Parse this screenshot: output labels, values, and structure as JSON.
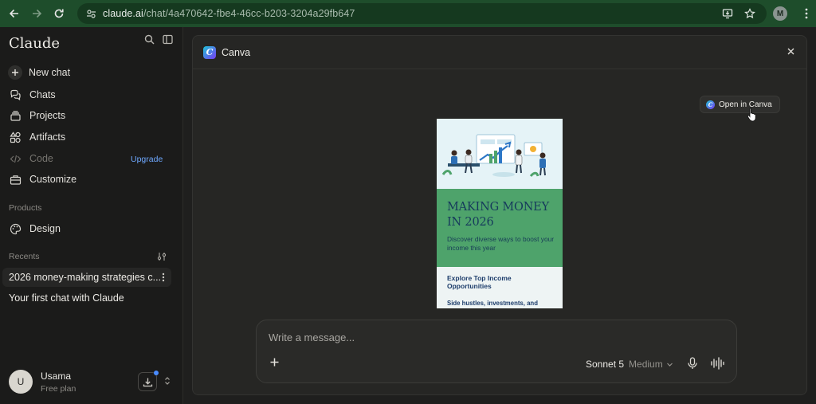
{
  "browser": {
    "url_host": "claude.ai",
    "url_path": "/chat/4a470642-fbe4-46cc-b203-3204a29fb647",
    "profile_initial": "M"
  },
  "sidebar": {
    "brand": "Claude",
    "items": [
      {
        "label": "New chat",
        "icon": "plus-icon"
      },
      {
        "label": "Chats",
        "icon": "chat-bubbles-icon"
      },
      {
        "label": "Projects",
        "icon": "folder-stack-icon"
      },
      {
        "label": "Artifacts",
        "icon": "shapes-icon"
      },
      {
        "label": "Code",
        "icon": "code-icon",
        "badge": "Upgrade"
      },
      {
        "label": "Customize",
        "icon": "briefcase-icon"
      }
    ],
    "products_label": "Products",
    "products": [
      {
        "label": "Design",
        "icon": "palette-icon"
      }
    ],
    "recents_label": "Recents",
    "recents": [
      {
        "label": "2026 money-making strategies c..."
      },
      {
        "label": "Your first chat with Claude"
      }
    ],
    "user": {
      "initial": "U",
      "name": "Usama",
      "plan": "Free plan"
    }
  },
  "panel": {
    "title": "Canva",
    "open_button": "Open in Canva",
    "design": {
      "title": "MAKING MONEY IN 2026",
      "subtitle": "Discover diverse ways to boost your income this year",
      "section_heading": "Explore Top Income Opportunities",
      "body": "Side hustles, investments, and"
    }
  },
  "composer": {
    "placeholder": "Write a message...",
    "model": "Sonnet 5",
    "effort": "Medium"
  },
  "colors": {
    "chrome": "#1e4d2b",
    "sidebar": "#1b1b1a",
    "panel": "#262624",
    "accent_link": "#6ea8ff",
    "design_green": "#4ea36b",
    "design_navy": "#163a5c"
  }
}
